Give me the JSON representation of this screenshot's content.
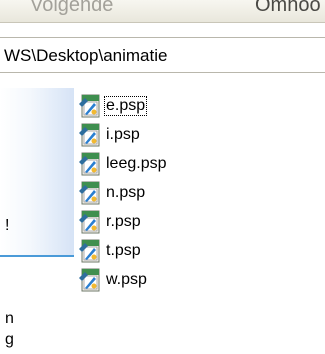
{
  "toolbar": {
    "prev_label": "Volgende",
    "next_label": "Omhoo"
  },
  "address": {
    "path": "WS\\Desktop\\animatie"
  },
  "left_panel": {
    "fragment_1": "!",
    "fragment_2": "n",
    "fragment_3": "g"
  },
  "files": [
    {
      "name": "e.psp",
      "focused": true
    },
    {
      "name": "i.psp"
    },
    {
      "name": "leeg.psp"
    },
    {
      "name": "n.psp"
    },
    {
      "name": "r.psp"
    },
    {
      "name": "t.psp"
    },
    {
      "name": "w.psp"
    }
  ],
  "icon": "psp-file-icon"
}
